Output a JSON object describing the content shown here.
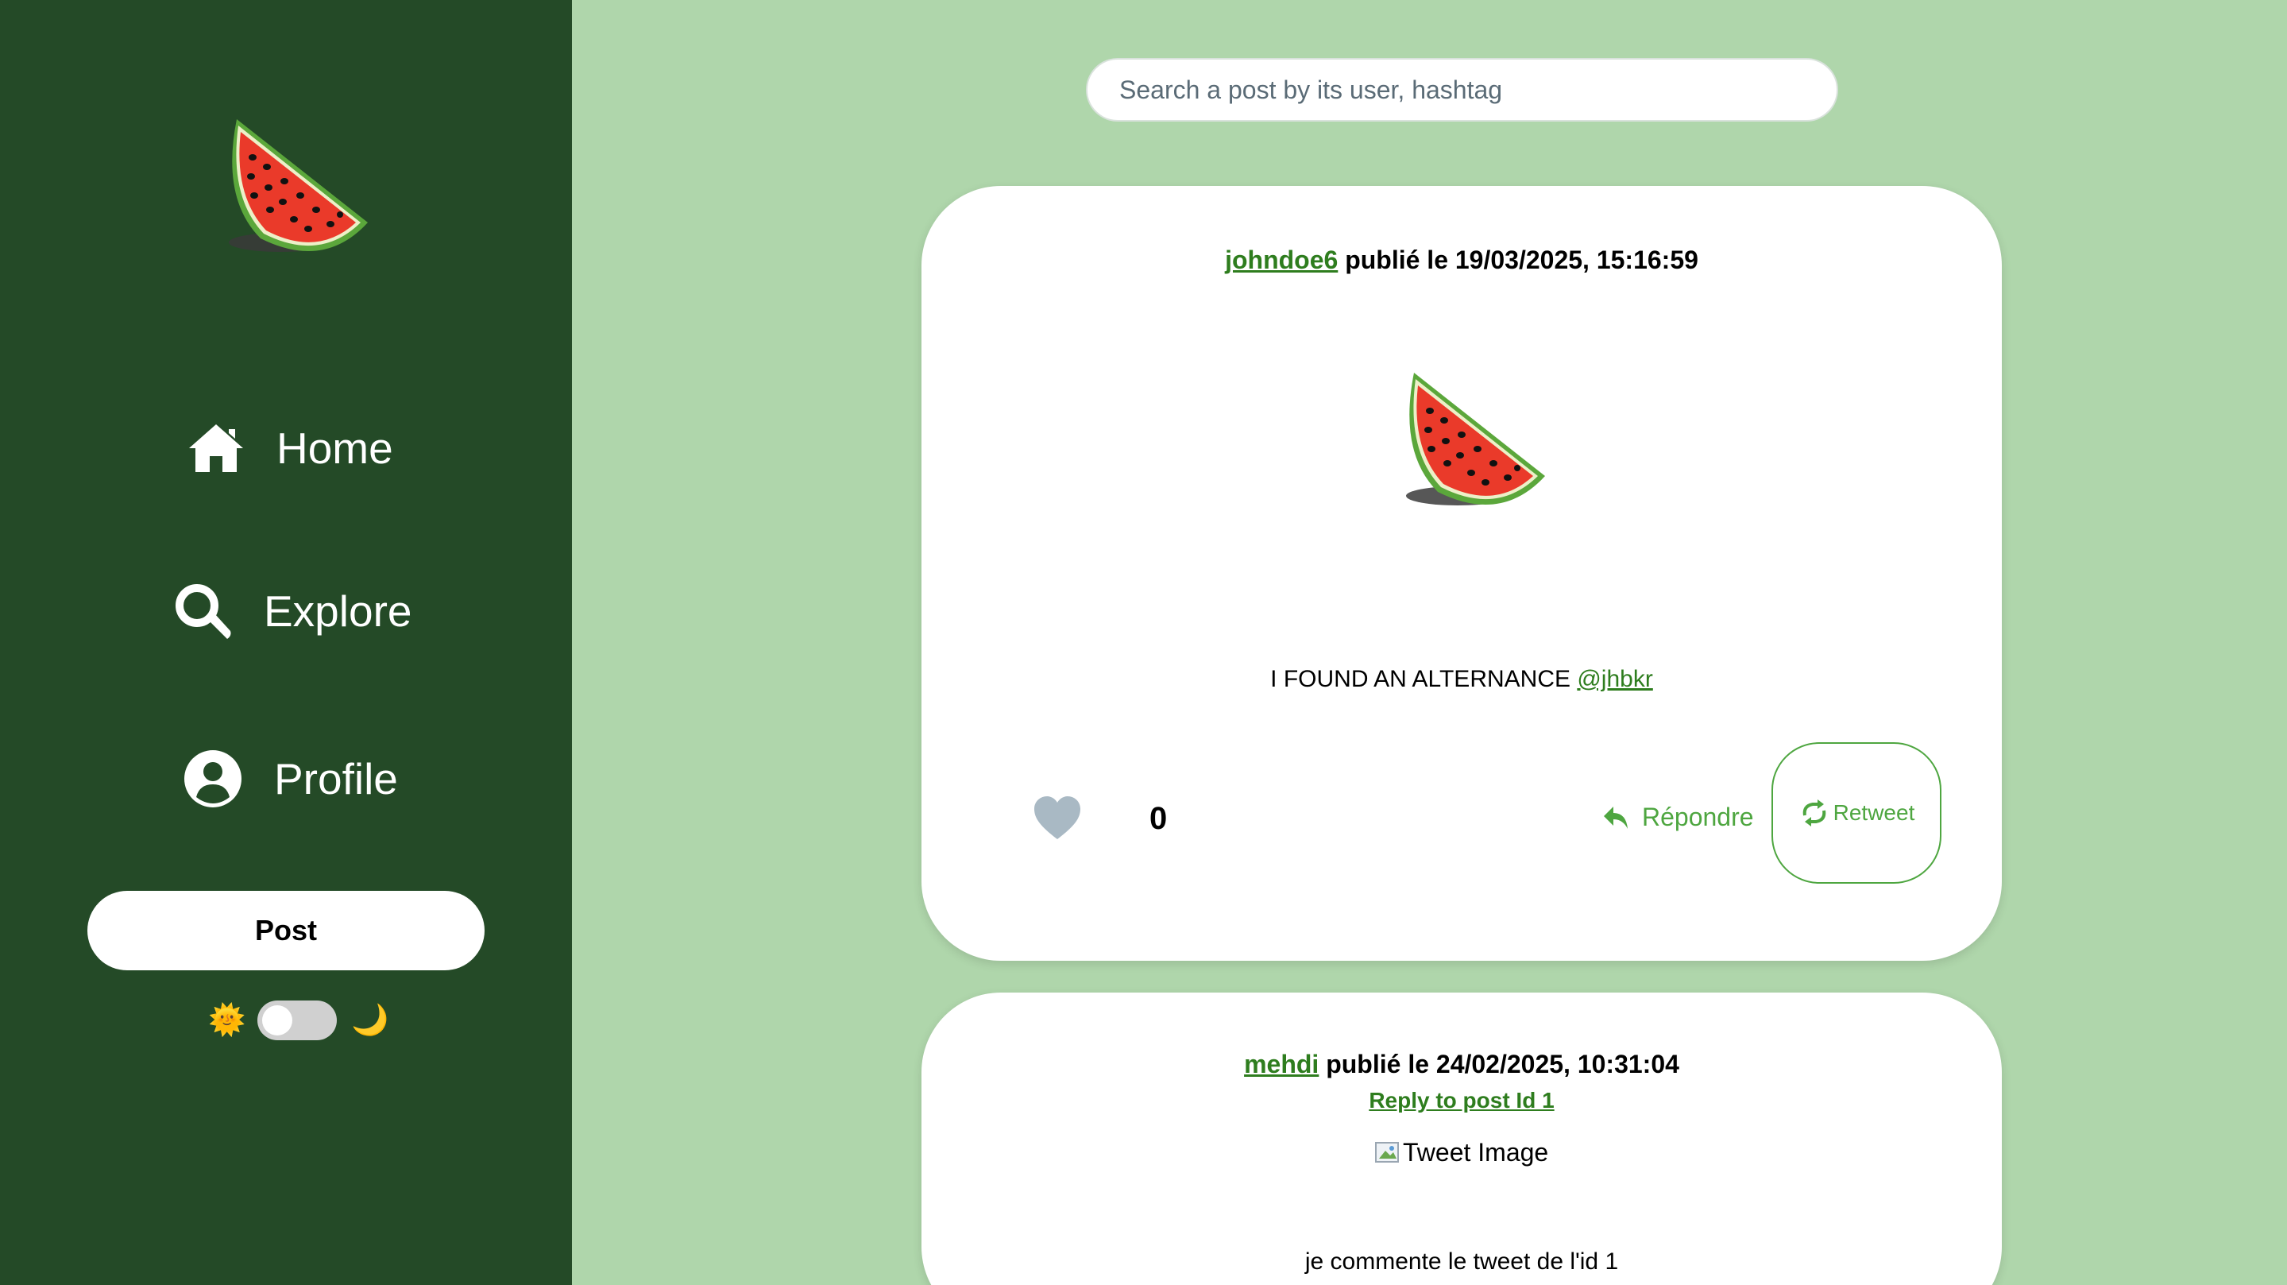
{
  "sidebar": {
    "nav": {
      "home": "Home",
      "explore": "Explore",
      "profile": "Profile"
    },
    "post_label": "Post",
    "theme": {
      "sun": "🌞",
      "moon": "🌙"
    }
  },
  "search": {
    "placeholder": "Search a post by its user, hashtag"
  },
  "posts": [
    {
      "username": "johndoe6",
      "published": "publié le 19/03/2025, 15:16:59",
      "text": "I FOUND AN ALTERNANCE",
      "mention": "@jhbkr",
      "likes": "0",
      "reply_label": "Répondre",
      "retweet_label": "Retweet"
    },
    {
      "username": "mehdi",
      "published": "publié le 24/02/2025, 10:31:04",
      "reply_to": "Reply to post Id 1",
      "image_alt": "Tweet Image",
      "text": "je commente le tweet de l'id 1"
    }
  ],
  "colors": {
    "sidebar": "#244a27",
    "background": "#afd6ab",
    "accent": "#4ea640",
    "link": "#2e7d1e"
  },
  "icons": [
    "watermelon-logo",
    "home-icon",
    "search-icon",
    "profile-icon",
    "sun-icon",
    "moon-icon",
    "heart-icon",
    "reply-icon",
    "retweet-icon",
    "broken-image-icon"
  ]
}
